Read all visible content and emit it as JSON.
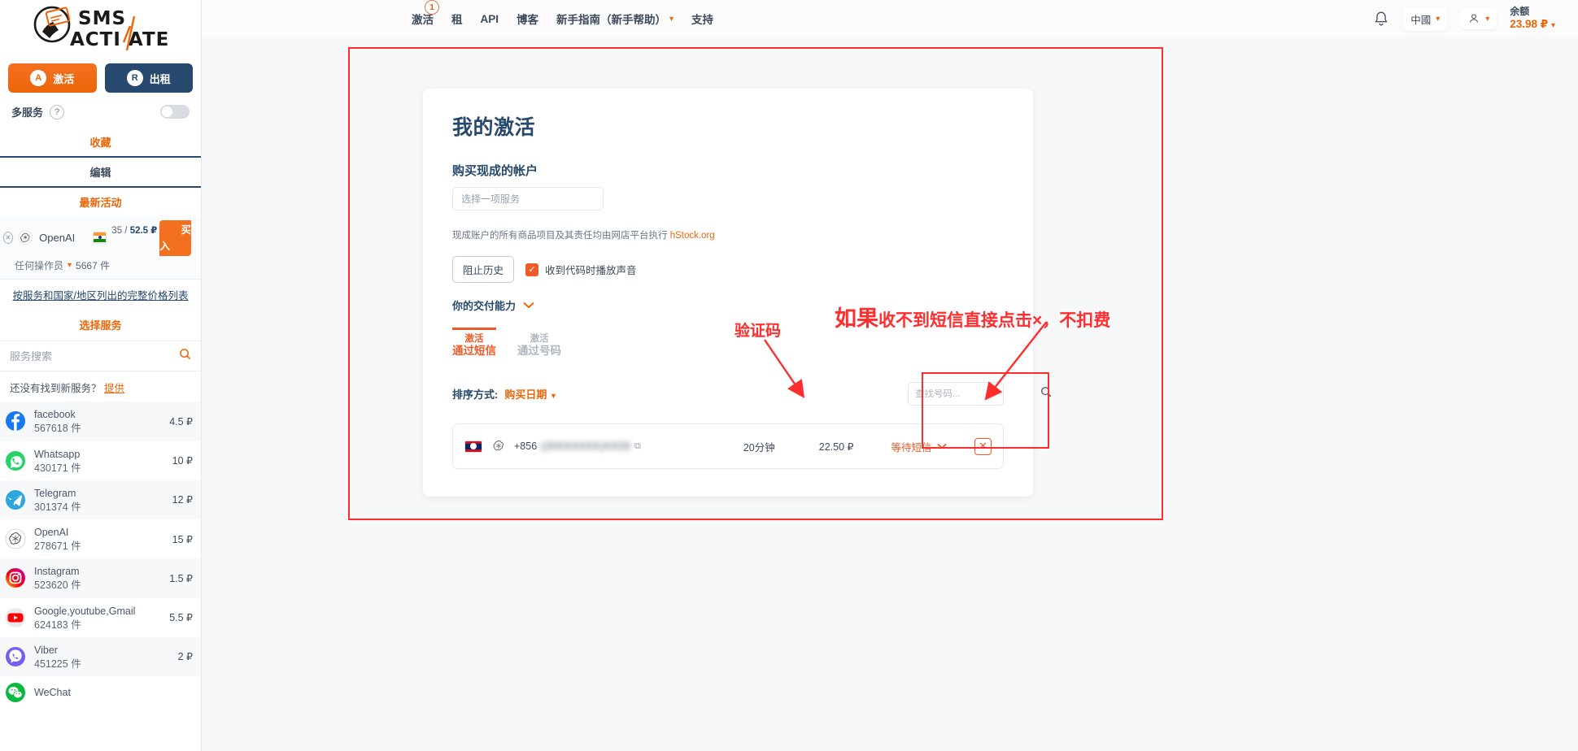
{
  "brand": {
    "name_top": "SMS",
    "name_bottom": "ACTIVATE"
  },
  "sidebar": {
    "mode_buttons": [
      {
        "label": "激活",
        "icon": "activate-icon",
        "state": "active"
      },
      {
        "label": "出租",
        "icon": "rent-icon",
        "state": "idle"
      }
    ],
    "multi_service": {
      "label": "多服务",
      "help": "?",
      "toggle": "off"
    },
    "links": {
      "favorites": "收藏",
      "edit": "编辑",
      "latest": "最新活动"
    },
    "favorite_card": {
      "service": "OpenAI",
      "icon": "openai-icon",
      "country_flag": "india-flag",
      "price": "35 / 52.5 ₽",
      "price_left": "35 /",
      "price_right": "52.5 ₽",
      "buy_label": "买入",
      "operator": "任何操作员",
      "count": "5667 件"
    },
    "price_list_link": "按服务和国家/地区列出的完整价格列表",
    "choose_service": "选择服务",
    "search": {
      "placeholder": "服务搜索",
      "value": "",
      "icon": "search-icon"
    },
    "not_found": {
      "text": "还没有找到新服务？",
      "link": "提供"
    },
    "services": [
      {
        "name": "facebook",
        "count": "567618",
        "unit": "件",
        "price": "4.5 ₽",
        "icon": "facebook-icon"
      },
      {
        "name": "Whatsapp",
        "count": "430171",
        "unit": "件",
        "price": "10 ₽",
        "icon": "whatsapp-icon"
      },
      {
        "name": "Telegram",
        "count": "301374",
        "unit": "件",
        "price": "12 ₽",
        "icon": "telegram-icon"
      },
      {
        "name": "OpenAI",
        "count": "278671",
        "unit": "件",
        "price": "15 ₽",
        "icon": "openai-icon"
      },
      {
        "name": "Instagram",
        "count": "523620",
        "unit": "件",
        "price": "1.5 ₽",
        "icon": "instagram-icon"
      },
      {
        "name": "Google,youtube,Gmail",
        "count": "624183",
        "unit": "件",
        "price": "5.5 ₽",
        "icon": "youtube-icon"
      },
      {
        "name": "Viber",
        "count": "451225",
        "unit": "件",
        "price": "2 ₽",
        "icon": "viber-icon"
      },
      {
        "name": "WeChat",
        "count": "",
        "unit": "",
        "price": "",
        "icon": "wechat-icon"
      }
    ]
  },
  "header": {
    "nav": [
      {
        "label": "激活",
        "badge": "1"
      },
      {
        "label": "租",
        "badge": ""
      },
      {
        "label": "API",
        "badge": ""
      },
      {
        "label": "博客",
        "badge": ""
      },
      {
        "label": "新手指南（新手帮助）",
        "badge": "",
        "caret": true
      },
      {
        "label": "支持",
        "badge": ""
      }
    ],
    "bell_icon": "bell-icon",
    "language": {
      "label": "中國",
      "icon": "chevron-down-icon"
    },
    "account": {
      "icon": "user-icon",
      "caret": "chevron-down-icon"
    },
    "balance": {
      "label": "余额",
      "value": "23.98 ₽"
    }
  },
  "main": {
    "title": "我的激活",
    "subtitle": "购买现成的帐户",
    "service_select": {
      "placeholder": "选择一项服务",
      "value": ""
    },
    "note": {
      "text": "现成账户的所有商品项目及其责任均由网店平台执行 ",
      "link": "hStock.org"
    },
    "block_history_button": "阻止历史",
    "sound_checkbox": {
      "label": "收到代码时播放声音",
      "checked": true
    },
    "delivery": {
      "label": "你的交付能力",
      "icon": "chevron-down-icon"
    },
    "tabs": [
      {
        "line1": "激活",
        "line2": "通过短信",
        "state": "active"
      },
      {
        "line1": "激活",
        "line2": "通过号码",
        "state": "idle"
      }
    ],
    "sort": {
      "label": "排序方式:",
      "value": "购买日期",
      "icon": "caret-down-icon"
    },
    "find": {
      "placeholder": "查找号码...",
      "value": "",
      "icon": "search-icon"
    },
    "order": {
      "country_flag": "laos-flag",
      "service_icon": "openai-icon",
      "number_prefix": "+856",
      "number_masked": "(20XXXXXX)XX33",
      "copy_icon": "copy-icon",
      "time": "20分钟",
      "price": "22.50 ₽",
      "status": "等待短信",
      "status_caret": "chevron-down-icon",
      "cancel_icon": "close-icon"
    }
  },
  "annotations": {
    "verification_code": "验证码",
    "tip_bold": "如果",
    "tip_rest": "收不到短信直接点击×，不扣费",
    "color": "#ff2d2d"
  }
}
